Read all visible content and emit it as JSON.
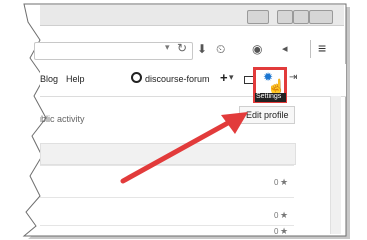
{
  "app": {
    "name": "discourse-forum"
  },
  "nav": {
    "blog": "Blog",
    "help": "Help"
  },
  "header": {
    "plus": "+",
    "dropdown": "▾"
  },
  "settings": {
    "tooltip": "Settings"
  },
  "profile": {
    "edit_button": "Edit profile",
    "public_activity": "Public activity"
  },
  "rows": [
    {
      "count": "0"
    },
    {
      "count": "0"
    },
    {
      "count": "0"
    }
  ],
  "icons": {
    "reload": "reload-icon",
    "download": "download-icon",
    "history": "history-icon",
    "globe": "globe-icon",
    "gear": "gear-icon",
    "menu": "hamburger-menu-icon",
    "cursor": "hand-pointer-icon",
    "star": "star-icon"
  },
  "colors": {
    "accent": "#e23b3b",
    "link": "#1b76d1",
    "panel": "#f1f1f1"
  }
}
